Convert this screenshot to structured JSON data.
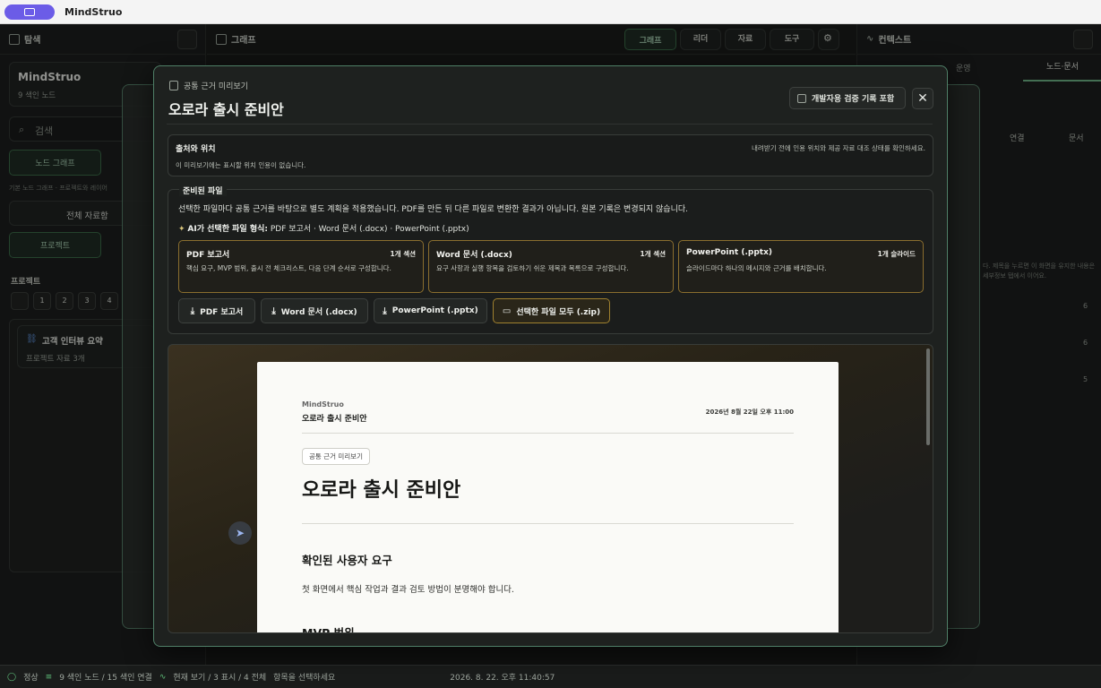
{
  "titlebar": {
    "app_title": "MindStruo"
  },
  "left": {
    "header": "탐색",
    "workspace_title": "MindStruo",
    "workspace_sub": "9 색인 노드",
    "search_placeholder": "검색",
    "node_graph_btn": "노드 그래프",
    "graph_hint": "기본 노드 그래프 · 프로젝트와 레이어",
    "all_sources_btn": "전체 자료함",
    "project_btn": "프로젝트",
    "projects_label": "프로젝트",
    "pages": [
      "1",
      "2",
      "3",
      "4"
    ],
    "project_card_title": "고객 인터뷰 요약",
    "project_card_sub": "프로젝트 자료 3개"
  },
  "center": {
    "header": "그래프",
    "tabs": [
      "그래프",
      "리더",
      "자료",
      "도구"
    ]
  },
  "right": {
    "header": "컨텍스트",
    "tabs": [
      "운영",
      "노드·문서"
    ],
    "actions": [
      "연결",
      "문서"
    ],
    "hint": "다. 제목을 누르면 이 화면을 유지한 내용은 세부정보 탭에서 이어요.",
    "counts": [
      "6",
      "6",
      "5"
    ]
  },
  "modal": {
    "kicker": "공통 근거 미리보기",
    "title": "오로라 출시 준비안",
    "dev_toggle": "개발자용 검증 기록 포함",
    "source": {
      "heading": "출처와 위치",
      "right_note": "내려받기 전에 인용 위치와 제공 자료 대조 상태를 확인하세요.",
      "desc": "이 미리보기에는 표시할 위치 인용이 없습니다."
    },
    "prepared": {
      "heading": "준비된 파일",
      "desc": "선택한 파일마다 공통 근거를 바탕으로 별도 계획을 적용했습니다. PDF를 만든 뒤 다른 파일로 변환한 결과가 아닙니다. 원본 기록은 변경되지 않습니다.",
      "ai_label": "AI가 선택한 파일 형식:",
      "ai_value": "PDF 보고서 · Word 문서 (.docx) · PowerPoint (.pptx)",
      "formats": [
        {
          "title": "PDF 보고서",
          "count": "1개 섹션",
          "desc": "핵심 요구, MVP 범위, 출시 전 체크리스트, 다음 단계 순서로 구성합니다."
        },
        {
          "title": "Word 문서 (.docx)",
          "count": "1개 섹션",
          "desc": "요구 사항과 실행 항목을 검토하기 쉬운 제목과 목록으로 구성합니다."
        },
        {
          "title": "PowerPoint (.pptx)",
          "count": "1개 슬라이드",
          "desc": "슬라이드마다 하나의 메시지와 근거를 배치합니다."
        }
      ],
      "downloads": [
        "PDF 보고서",
        "Word 문서 (.docx)",
        "PowerPoint (.pptx)",
        "선택한 파일 모두 (.zip)"
      ]
    },
    "doc": {
      "brand": "MindStruo",
      "name": "오로라 출시 준비안",
      "date": "2026년 8월 22일 오후 11:00",
      "badge": "공통 근거 미리보기",
      "title": "오로라 출시 준비안",
      "section1": "확인된 사용자 요구",
      "para1": "첫 화면에서 핵심 작업과 결과 검토 방법이 분명해야 합니다.",
      "section2": "MVP 범위"
    }
  },
  "status": {
    "state": "정상",
    "index": "9 색인 노드 / 15 색인 연결",
    "view": "현재 보기 / 3 표시 / 4 전체",
    "select": "항목을 선택하세요",
    "time": "2026. 8. 22. 오후 11:40:57"
  }
}
